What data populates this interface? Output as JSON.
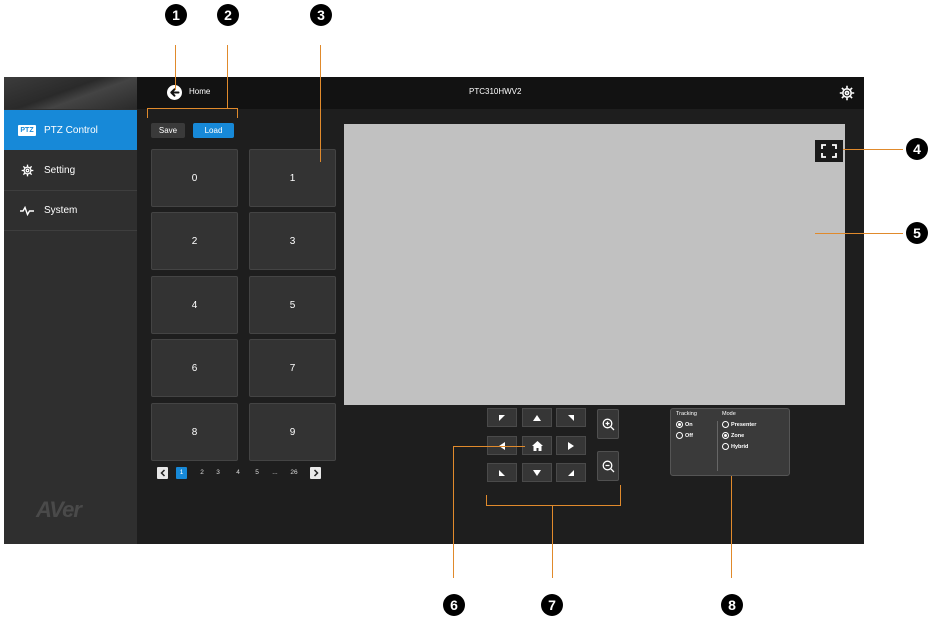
{
  "callouts": [
    "1",
    "2",
    "3",
    "4",
    "5",
    "6",
    "7",
    "8"
  ],
  "colors": {
    "accent": "#1789d8",
    "callout_line": "#e08a2c",
    "video_bg": "#c1c1c1"
  },
  "header": {
    "back_label": "Home",
    "device_name": "PTC310HWV2",
    "settings_icon": "gear-icon",
    "back_icon": "back-arrow-icon"
  },
  "sidebar": {
    "items": [
      {
        "label": "PTZ Control",
        "icon": "ptz-icon",
        "active": true
      },
      {
        "label": "Setting",
        "icon": "gear-icon",
        "active": false
      },
      {
        "label": "System",
        "icon": "pulse-icon",
        "active": false
      }
    ],
    "logo": "AVer"
  },
  "presets": {
    "save_label": "Save",
    "load_label": "Load",
    "buttons": [
      "0",
      "1",
      "2",
      "3",
      "4",
      "5",
      "6",
      "7",
      "8",
      "9"
    ],
    "pagination": {
      "pages": [
        "1",
        "2",
        "3",
        "4",
        "5",
        "...",
        "26"
      ],
      "current": "1"
    }
  },
  "tracking": {
    "tracking_title": "Tracking",
    "tracking_options": [
      "On",
      "Off"
    ],
    "tracking_selected": "On",
    "mode_title": "Mode",
    "mode_options": [
      "Presenter",
      "Zone",
      "Hybrid"
    ],
    "mode_selected": "Zone"
  }
}
